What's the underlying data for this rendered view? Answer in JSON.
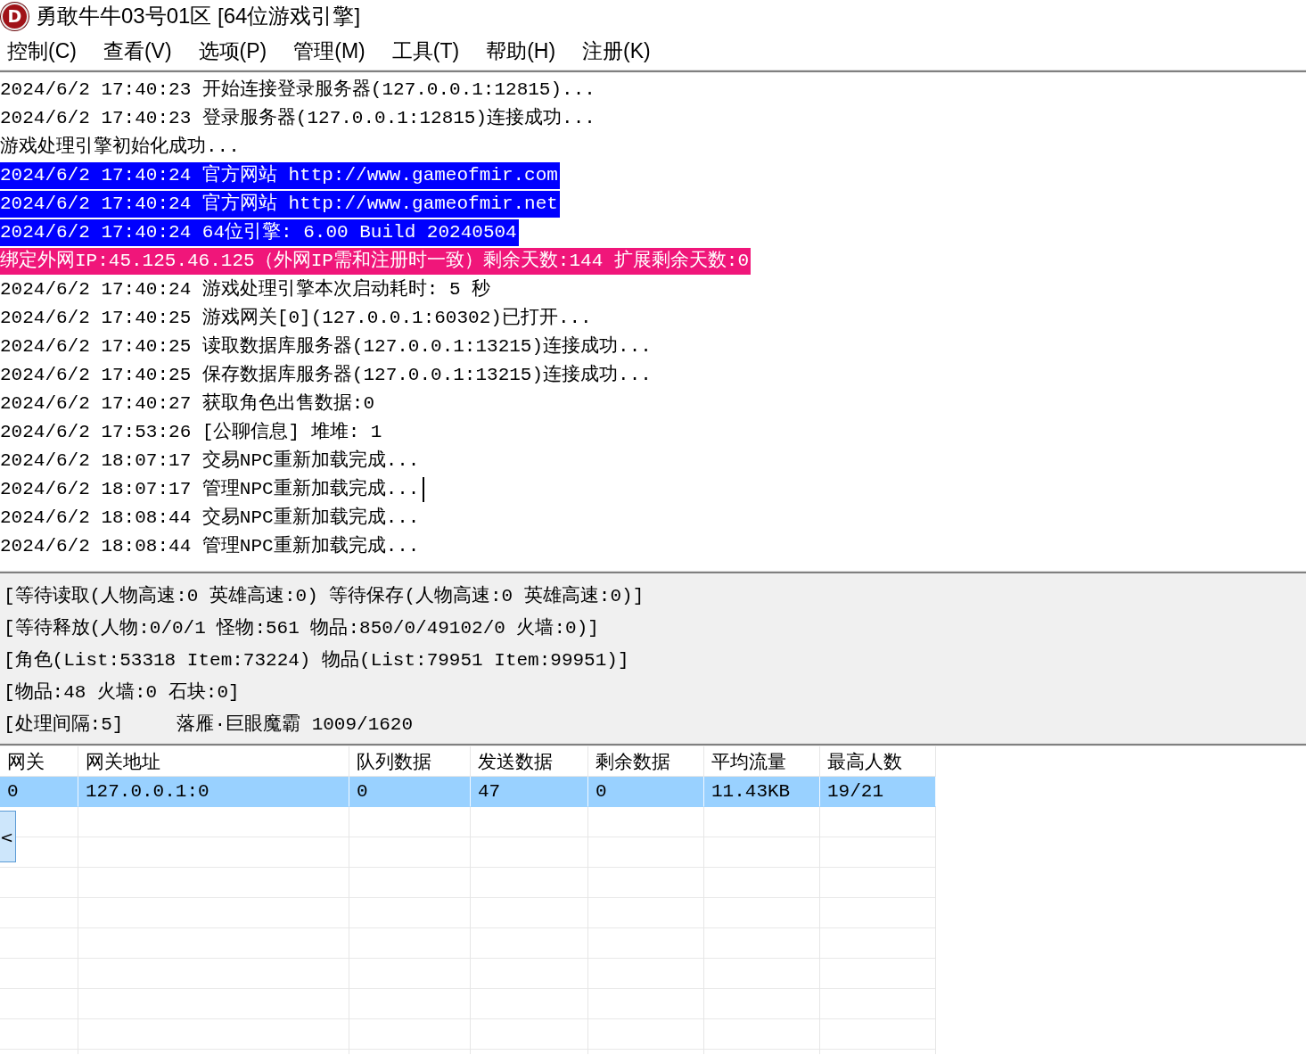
{
  "window": {
    "logo": "D",
    "title": "勇敢牛牛03号01区 [64位游戏引擎]"
  },
  "menu": [
    "控制(C)",
    "查看(V)",
    "选项(P)",
    "管理(M)",
    "工具(T)",
    "帮助(H)",
    "注册(K)"
  ],
  "log": {
    "lines": [
      {
        "text": "2024/6/2 17:40:23 开始连接登录服务器(127.0.0.1:12815)...",
        "caret": false
      },
      {
        "text": "2024/6/2 17:40:23 登录服务器(127.0.0.1:12815)连接成功...",
        "caret": false
      },
      {
        "text": "游戏处理引擎初始化成功...",
        "caret": false
      },
      {
        "text": "2024/6/2 17:40:24 官方网站 http://www.gameofmir.com",
        "caret": false,
        "color": "#0000ff"
      },
      {
        "text": "2024/6/2 17:40:24 官方网站 http://www.gameofmir.net",
        "caret": false,
        "color": "#0000ff"
      },
      {
        "text": "2024/6/2 17:40:24 64位引擎: 6.00 Build 20240504",
        "caret": false,
        "color": "#0000ff"
      },
      {
        "text": "绑定外网IP:45.125.46.125（外网IP需和注册时一致）剩余天数:144 扩展剩余天数:0",
        "caret": false,
        "color": "#f0167a"
      },
      {
        "text": "2024/6/2 17:40:24 游戏处理引擎本次启动耗时: 5 秒",
        "caret": false
      },
      {
        "text": "2024/6/2 17:40:25 游戏网关[0](127.0.0.1:60302)已打开...",
        "caret": false
      },
      {
        "text": "2024/6/2 17:40:25 读取数据库服务器(127.0.0.1:13215)连接成功...",
        "caret": false
      },
      {
        "text": "2024/6/2 17:40:25 保存数据库服务器(127.0.0.1:13215)连接成功...",
        "caret": false
      },
      {
        "text": "2024/6/2 17:40:27 获取角色出售数据:0",
        "caret": false
      },
      {
        "text": "2024/6/2 17:53:26 [公聊信息] 堆堆: 1",
        "caret": false
      },
      {
        "text": "2024/6/2 18:07:17 交易NPC重新加载完成...",
        "caret": false
      },
      {
        "text": "2024/6/2 18:07:17 管理NPC重新加载完成...",
        "caret": true
      },
      {
        "text": "2024/6/2 18:08:44 交易NPC重新加载完成...",
        "caret": false
      },
      {
        "text": "2024/6/2 18:08:44 管理NPC重新加载完成...",
        "caret": false
      }
    ]
  },
  "status": {
    "lines": [
      [
        "[等待读取(人物高速:0 英雄高速:0) 等待保存(人物高速:0 英雄高速:0)]"
      ],
      [
        "[等待释放(人物:0/0/1 怪物:561 物品:850/0/49102/0 火墙:0)]"
      ],
      [
        "[角色(List:53318 Item:73224) 物品(List:79951 Item:99951)]"
      ],
      [
        "[物品:48 火墙:0 石块:0]"
      ],
      [
        "[处理间隔:5]",
        "落雁·巨眼魔霸 1009/1620"
      ]
    ]
  },
  "table": {
    "columns": [
      "网关",
      "网关地址",
      "队列数据",
      "发送数据",
      "剩余数据",
      "平均流量",
      "最高人数"
    ],
    "rows": [
      {
        "cells": [
          "0",
          "127.0.0.1:0",
          "0",
          "47",
          "0",
          "11.43KB",
          "19/21"
        ],
        "selected": true
      }
    ]
  },
  "side_button": {
    "label": "<"
  }
}
